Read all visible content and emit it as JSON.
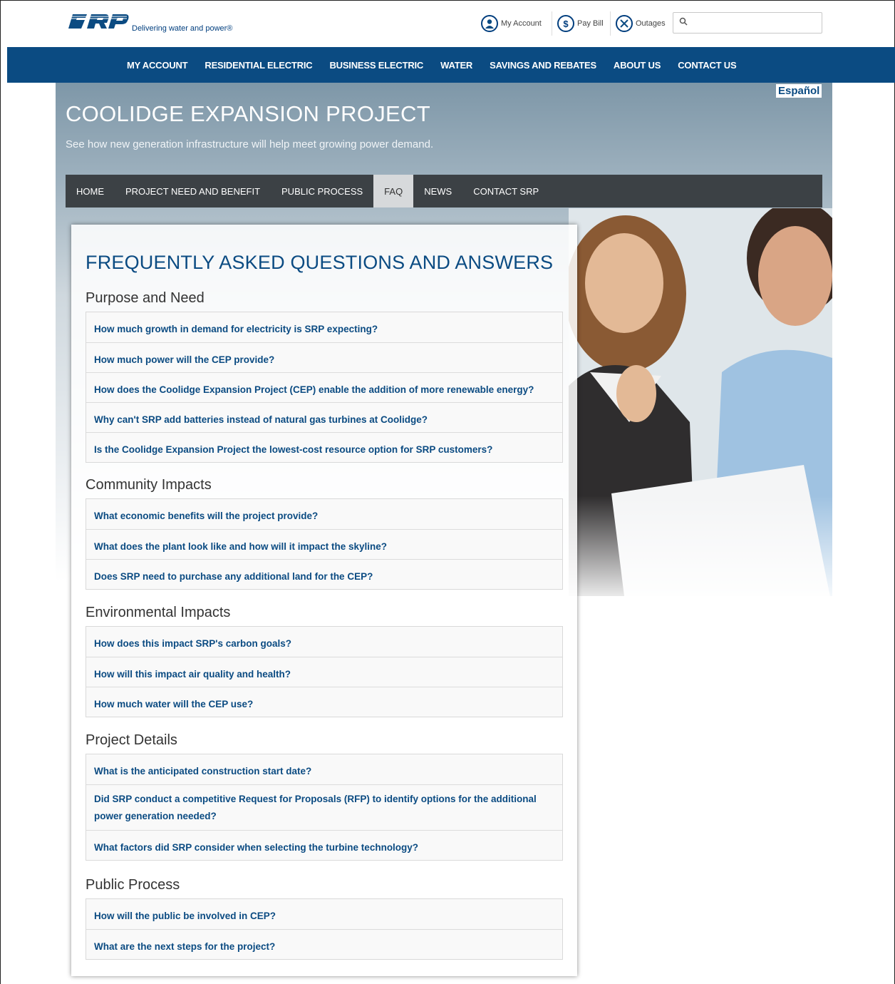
{
  "header": {
    "tagline": "Delivering water and power®",
    "utility": [
      {
        "label": "My Account",
        "icon": "user-icon"
      },
      {
        "label": "Pay Bill",
        "icon": "dollar-icon"
      },
      {
        "label": "Outages",
        "icon": "outage-icon"
      }
    ],
    "search_placeholder": ""
  },
  "mainnav": [
    "MY ACCOUNT",
    "RESIDENTIAL ELECTRIC",
    "BUSINESS ELECTRIC",
    "WATER",
    "SAVINGS AND REBATES",
    "ABOUT US",
    "CONTACT US"
  ],
  "language_link": "Español",
  "hero": {
    "title": "COOLIDGE EXPANSION PROJECT",
    "subtitle": "See how new generation infrastructure will help meet growing power demand."
  },
  "subnav": {
    "items": [
      "HOME",
      "PROJECT NEED AND BENEFIT",
      "PUBLIC PROCESS",
      "FAQ",
      "NEWS",
      "CONTACT SRP"
    ],
    "active": "FAQ"
  },
  "faq": {
    "title": "FREQUENTLY ASKED QUESTIONS AND ANSWERS",
    "sections": [
      {
        "heading": "Purpose and Need",
        "questions": [
          "How much growth in demand for electricity is SRP expecting?",
          "How much power will the CEP provide?",
          "How does the Coolidge Expansion Project (CEP) enable the addition of more renewable energy?",
          "Why can't SRP add batteries instead of natural gas turbines at Coolidge?",
          "Is the Coolidge Expansion Project the lowest-cost resource option for SRP customers?"
        ]
      },
      {
        "heading": "Community Impacts",
        "questions": [
          "What economic benefits will the project provide?",
          "What does the plant look like and how will it impact the skyline?",
          "Does SRP need to purchase any additional land for the CEP?"
        ]
      },
      {
        "heading": "Environmental Impacts",
        "questions": [
          "How does this impact SRP's carbon goals?",
          "How will this impact air quality and health?",
          "How much water will the CEP use?"
        ]
      },
      {
        "heading": "Project Details",
        "questions": [
          "What is the anticipated construction start date?",
          "Did SRP conduct a competitive Request for Proposals (RFP) to identify options for the additional power generation needed?",
          "What factors did SRP consider when selecting the turbine technology?"
        ]
      },
      {
        "heading": "Public Process",
        "questions": [
          "How will the public be involved in CEP?",
          "What are the next steps for the project?"
        ]
      }
    ]
  },
  "colors": {
    "brand_blue": "#0b4b82",
    "subnav_bg": "#3c4145",
    "active_tab": "#d7d9db"
  }
}
